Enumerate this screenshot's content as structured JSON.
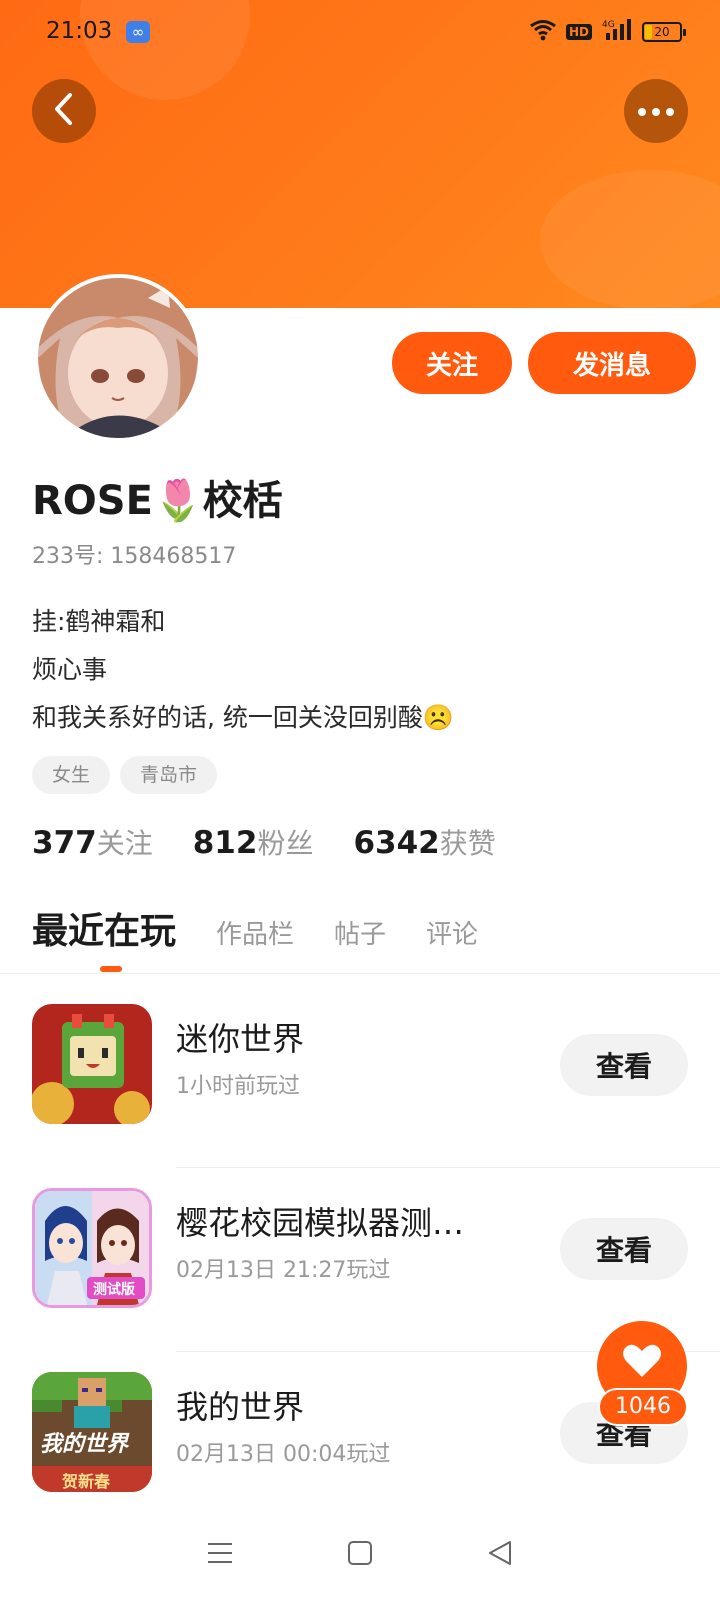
{
  "status_bar": {
    "time": "21:03",
    "app_indicator": "∞",
    "hd_label": "HD",
    "network": "4G",
    "battery": "20"
  },
  "header": {
    "back_icon": "chevron-left-icon",
    "more_icon": "more-dots-icon"
  },
  "profile": {
    "name": "ROSE🌷校栝",
    "uid_label": "233号:",
    "uid": "158468517",
    "bio_lines": [
      "挂:鹤神霜和",
      "烦心事",
      "和我关系好的话, 统一回关没回别酸☹️"
    ],
    "tags": [
      "女生",
      "青岛市"
    ],
    "follow_label": "关注",
    "message_label": "发消息"
  },
  "stats": {
    "following_count": "377",
    "following_label": "关注",
    "fans_count": "812",
    "fans_label": "粉丝",
    "likes_count": "6342",
    "likes_label": "获赞"
  },
  "tabs": [
    "最近在玩",
    "作品栏",
    "帖子",
    "评论"
  ],
  "games": [
    {
      "title": "迷你世界",
      "played": "1小时前玩过",
      "view_label": "查看"
    },
    {
      "title": "樱花校园模拟器测…",
      "played": "02月13日 21:27玩过",
      "view_label": "查看",
      "badge": "测试版"
    },
    {
      "title": "我的世界",
      "played": "02月13日 00:04玩过",
      "view_label": "查看",
      "icon_text": "我的世界",
      "icon_sub": "贺新春"
    }
  ],
  "like_fab": {
    "count": "1046"
  },
  "colors": {
    "accent": "#ff5a0e",
    "banner": "#ff7a1a"
  }
}
